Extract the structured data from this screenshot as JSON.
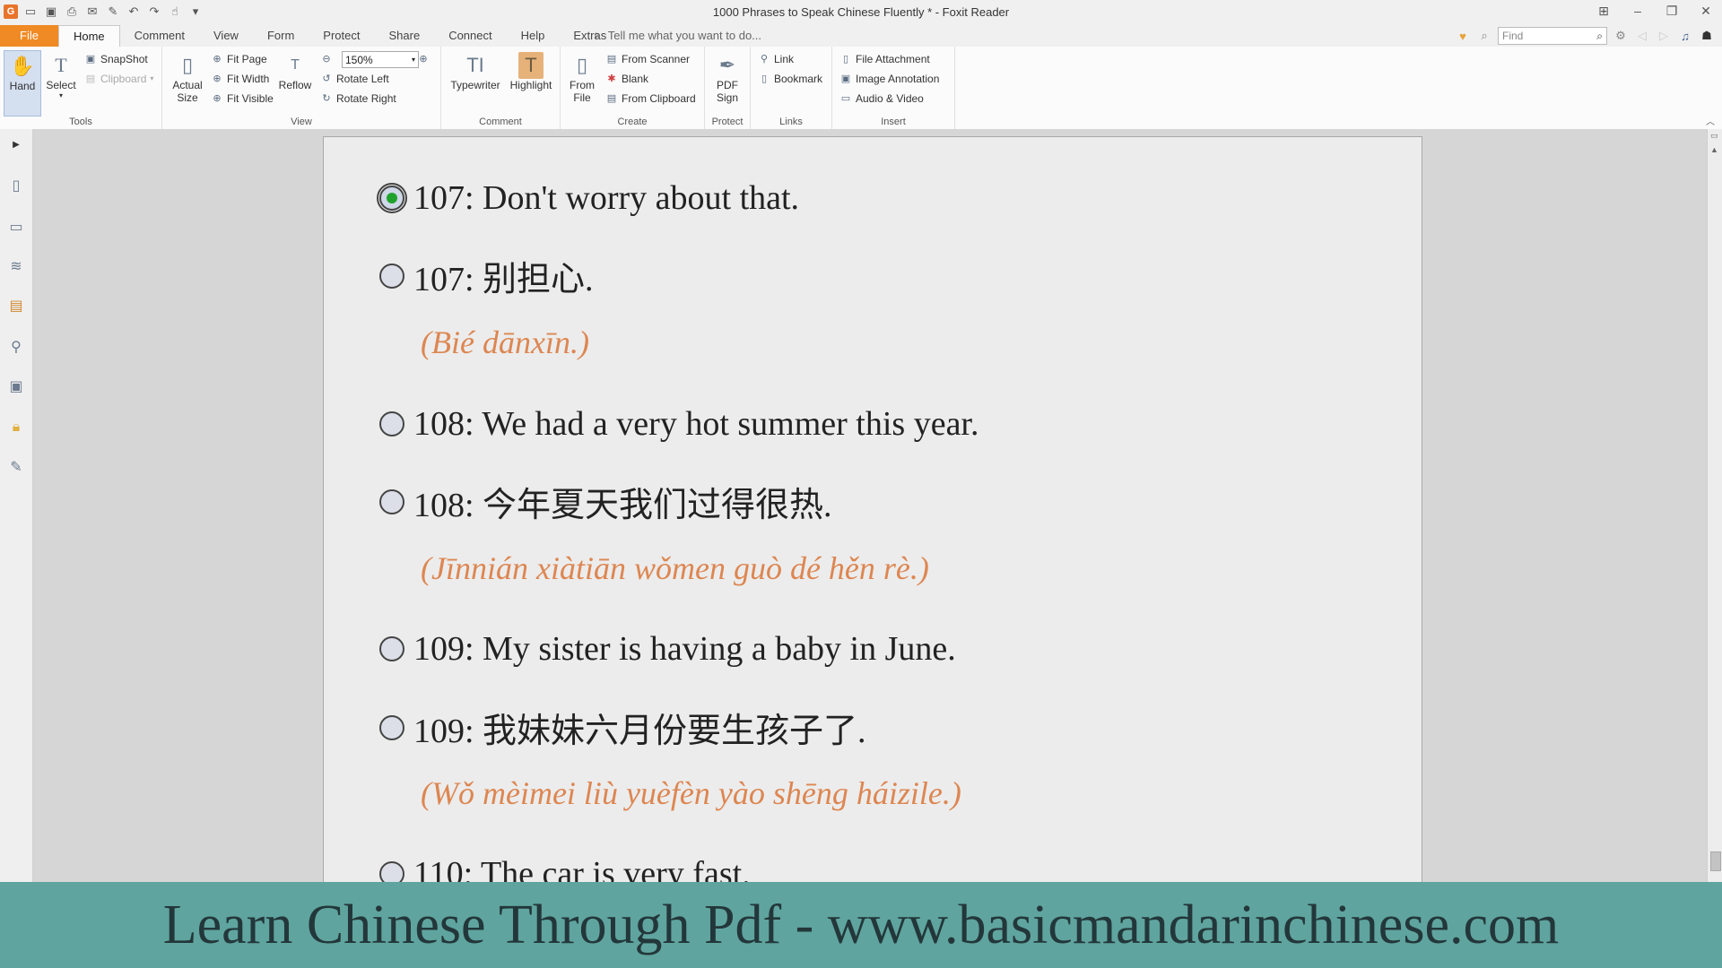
{
  "window": {
    "title": "1000 Phrases to Speak Chinese Fluently * - Foxit Reader",
    "app_logo": "G"
  },
  "menu": {
    "tabs": [
      "File",
      "Home",
      "Comment",
      "View",
      "Form",
      "Protect",
      "Share",
      "Connect",
      "Help",
      "Extras"
    ],
    "active_tab": "Home",
    "tell_me": "Tell me what you want to do...",
    "find_placeholder": "Find"
  },
  "ribbon": {
    "tools": {
      "label": "Tools",
      "hand": "Hand",
      "select": "Select",
      "snapshot": "SnapShot",
      "clipboard": "Clipboard"
    },
    "view": {
      "label": "View",
      "actual_size": "Actual Size",
      "fit_page": "Fit Page",
      "fit_width": "Fit Width",
      "fit_visible": "Fit Visible",
      "reflow": "Reflow",
      "zoom": "150%",
      "rotate_left": "Rotate Left",
      "rotate_right": "Rotate Right"
    },
    "comment": {
      "label": "Comment",
      "typewriter": "Typewriter",
      "highlight": "Highlight"
    },
    "create": {
      "label": "Create",
      "from_file": "From File",
      "from_scanner": "From Scanner",
      "blank": "Blank",
      "from_clipboard": "From Clipboard"
    },
    "protect": {
      "label": "Protect",
      "pdf_sign": "PDF Sign"
    },
    "links": {
      "label": "Links",
      "link": "Link",
      "bookmark": "Bookmark"
    },
    "insert": {
      "label": "Insert",
      "file_attachment": "File Attachment",
      "image_annotation": "Image Annotation",
      "audio_video": "Audio & Video"
    }
  },
  "document": {
    "lines": [
      {
        "text": "107: Don't worry about that.",
        "selected": true
      },
      {
        "text": "107: 别担心.",
        "pinyin": "(Bié dānxīn.)"
      },
      {
        "text": "108: We had a very hot summer this year."
      },
      {
        "text": "108: 今年夏天我们过得很热.",
        "pinyin": "(Jīnnián xiàtiān wǒmen guò dé hěn rè.)"
      },
      {
        "text": "109: My sister is having a baby in June."
      },
      {
        "text": "109: 我妹妹六月份要生孩子了.",
        "pinyin": "(Wǒ mèimei liù yuèfèn yào shēng háizile.)"
      },
      {
        "text": "110: The car is very fast."
      }
    ]
  },
  "banner": {
    "text": "Learn Chinese Through Pdf - www.basicmandarinchinese.com",
    "color": "#5fa49f"
  },
  "colors": {
    "file_tab": "#f08a24",
    "pinyin": "#dd8651",
    "radio_dot": "#1fa22c"
  }
}
